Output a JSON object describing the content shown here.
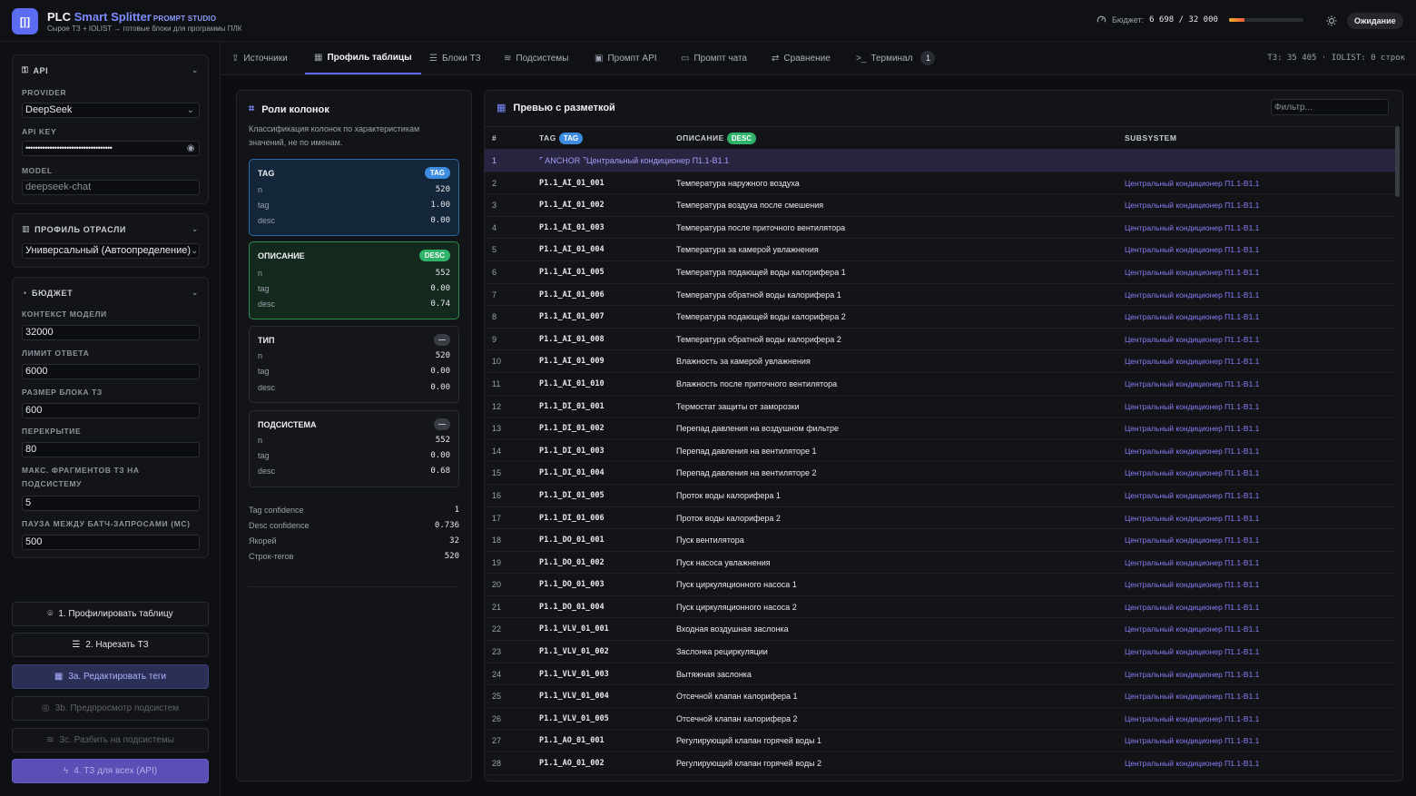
{
  "header": {
    "logo_glyph": "[|]",
    "title_part1": "PLC ",
    "title_part2": "Smart Splitter",
    "title_small": "PROMPT STUDIO",
    "subtitle": "Сырое ТЗ + IOLIST → готовые блоки для программы ПЛК",
    "budget_label": "Бюджет:",
    "budget_value": "6 698 / 32 000",
    "budget_fraction": 0.209,
    "status": "Ожидание"
  },
  "sidebar": {
    "api": {
      "title": "API",
      "provider_label": "PROVIDER",
      "provider_value": "DeepSeek",
      "apikey_label": "API KEY",
      "apikey_value": "••••••••••••••••••••••••••••••••••••",
      "model_label": "MODEL",
      "model_value": "deepseek-chat"
    },
    "industry": {
      "title": "ПРОФИЛЬ ОТРАСЛИ",
      "value": "Универсальный (Автоопределение)"
    },
    "budget": {
      "title": "БЮДЖЕТ",
      "context_label": "КОНТЕКСТ МОДЕЛИ",
      "context_value": "32000",
      "answer_label": "ЛИМИТ ОТВЕТА",
      "answer_value": "6000",
      "block_label": "РАЗМЕР БЛОКА ТЗ",
      "block_value": "600",
      "overlap_label": "ПЕРЕКРЫТИЕ",
      "overlap_value": "80",
      "maxfrag_label_1": "МАКС. ФРАГМЕНТОВ ТЗ НА",
      "maxfrag_label_2": "ПОДСИСТЕМУ",
      "maxfrag_value": "5",
      "pause_label": "ПАУЗА МЕЖДУ БАТЧ-ЗАПРОСАМИ (МС)",
      "pause_value": "500"
    },
    "buttons": {
      "profile": "1. Профилировать таблицу",
      "cut": "2. Нарезать ТЗ",
      "edit_tags": "3a. Редактировать теги",
      "preview_subsystems": "3b. Предпросмотр подсистем",
      "split_subsystems": "3c. Разбить на подсистемы",
      "tz_all": "4. ТЗ для всех (API)"
    }
  },
  "tabs": {
    "sources": "Источники",
    "profile": "Профиль таблицы",
    "blocks": "Блоки ТЗ",
    "subsystems": "Подсистемы",
    "prompt_api": "Промпт API",
    "prompt_chat": "Промпт чата",
    "compare": "Сравнение",
    "terminal": "Терминал",
    "terminal_count": "1",
    "info": "ТЗ: 35 405 · IOLIST: 0 строк"
  },
  "roles": {
    "title": "Роли колонок",
    "description": "Классификация колонок по характеристикам значений, не по именам.",
    "cards": [
      {
        "name": "TAG",
        "badge": "TAG",
        "n": "520",
        "tag": "1.00",
        "desc": "0.00"
      },
      {
        "name": "ОПИСАНИЕ",
        "badge": "DESC",
        "n": "552",
        "tag": "0.00",
        "desc": "0.74"
      },
      {
        "name": "ТИП",
        "badge": "—",
        "n": "520",
        "tag": "0.00",
        "desc": "0.00"
      },
      {
        "name": "ПОДСИСТЕМА",
        "badge": "—",
        "n": "552",
        "tag": "0.00",
        "desc": "0.68"
      }
    ],
    "row_labels": {
      "n": "n",
      "tag": "tag",
      "desc": "desc"
    },
    "stats": [
      {
        "label": "Tag confidence",
        "value": "1"
      },
      {
        "label": "Desc confidence",
        "value": "0.736"
      },
      {
        "label": "Якорей",
        "value": "32"
      },
      {
        "label": "Строк-тегов",
        "value": "520"
      }
    ]
  },
  "preview": {
    "title": "Превью с разметкой",
    "filter_placeholder": "Фильтр...",
    "columns": {
      "num": "#",
      "tag": "TAG",
      "tag_badge": "TAG",
      "desc": "ОПИСАНИЕ",
      "desc_badge": "DESC",
      "sub": "SUBSYSTEM"
    },
    "anchor": {
      "num": "1",
      "text": "⌜ ANCHOR ⌝Центральный кондиционер П1.1-В1.1"
    },
    "rows": [
      {
        "num": "2",
        "tag": "P1.1_AI_01_001",
        "desc": "Температура наружного воздуха",
        "sub": "Центральный кондиционер П1.1-В1.1"
      },
      {
        "num": "3",
        "tag": "P1.1_AI_01_002",
        "desc": "Температура воздуха после смешения",
        "sub": "Центральный кондиционер П1.1-В1.1"
      },
      {
        "num": "4",
        "tag": "P1.1_AI_01_003",
        "desc": "Температура после приточного вентилятора",
        "sub": "Центральный кондиционер П1.1-В1.1"
      },
      {
        "num": "5",
        "tag": "P1.1_AI_01_004",
        "desc": "Температура за камерой увлажнения",
        "sub": "Центральный кондиционер П1.1-В1.1"
      },
      {
        "num": "6",
        "tag": "P1.1_AI_01_005",
        "desc": "Температура подающей воды калорифера 1",
        "sub": "Центральный кондиционер П1.1-В1.1"
      },
      {
        "num": "7",
        "tag": "P1.1_AI_01_006",
        "desc": "Температура обратной воды калорифера 1",
        "sub": "Центральный кондиционер П1.1-В1.1"
      },
      {
        "num": "8",
        "tag": "P1.1_AI_01_007",
        "desc": "Температура подающей воды калорифера 2",
        "sub": "Центральный кондиционер П1.1-В1.1"
      },
      {
        "num": "9",
        "tag": "P1.1_AI_01_008",
        "desc": "Температура обратной воды калорифера 2",
        "sub": "Центральный кондиционер П1.1-В1.1"
      },
      {
        "num": "10",
        "tag": "P1.1_AI_01_009",
        "desc": "Влажность за камерой увлажнения",
        "sub": "Центральный кондиционер П1.1-В1.1"
      },
      {
        "num": "11",
        "tag": "P1.1_AI_01_010",
        "desc": "Влажность после приточного вентилятора",
        "sub": "Центральный кондиционер П1.1-В1.1"
      },
      {
        "num": "12",
        "tag": "P1.1_DI_01_001",
        "desc": "Термостат защиты от заморозки",
        "sub": "Центральный кондиционер П1.1-В1.1"
      },
      {
        "num": "13",
        "tag": "P1.1_DI_01_002",
        "desc": "Перепад давления на воздушном фильтре",
        "sub": "Центральный кондиционер П1.1-В1.1"
      },
      {
        "num": "14",
        "tag": "P1.1_DI_01_003",
        "desc": "Перепад давления на вентиляторе 1",
        "sub": "Центральный кондиционер П1.1-В1.1"
      },
      {
        "num": "15",
        "tag": "P1.1_DI_01_004",
        "desc": "Перепад давления на вентиляторе 2",
        "sub": "Центральный кондиционер П1.1-В1.1"
      },
      {
        "num": "16",
        "tag": "P1.1_DI_01_005",
        "desc": "Проток воды калорифера 1",
        "sub": "Центральный кондиционер П1.1-В1.1"
      },
      {
        "num": "17",
        "tag": "P1.1_DI_01_006",
        "desc": "Проток воды калорифера 2",
        "sub": "Центральный кондиционер П1.1-В1.1"
      },
      {
        "num": "18",
        "tag": "P1.1_DO_01_001",
        "desc": "Пуск вентилятора",
        "sub": "Центральный кондиционер П1.1-В1.1"
      },
      {
        "num": "19",
        "tag": "P1.1_DO_01_002",
        "desc": "Пуск насоса увлажнения",
        "sub": "Центральный кондиционер П1.1-В1.1"
      },
      {
        "num": "20",
        "tag": "P1.1_DO_01_003",
        "desc": "Пуск циркуляционного насоса 1",
        "sub": "Центральный кондиционер П1.1-В1.1"
      },
      {
        "num": "21",
        "tag": "P1.1_DO_01_004",
        "desc": "Пуск циркуляционного насоса 2",
        "sub": "Центральный кондиционер П1.1-В1.1"
      },
      {
        "num": "22",
        "tag": "P1.1_VLV_01_001",
        "desc": "Входная воздушная заслонка",
        "sub": "Центральный кондиционер П1.1-В1.1"
      },
      {
        "num": "23",
        "tag": "P1.1_VLV_01_002",
        "desc": "Заслонка рециркуляции",
        "sub": "Центральный кондиционер П1.1-В1.1"
      },
      {
        "num": "24",
        "tag": "P1.1_VLV_01_003",
        "desc": "Вытяжная заслонка",
        "sub": "Центральный кондиционер П1.1-В1.1"
      },
      {
        "num": "25",
        "tag": "P1.1_VLV_01_004",
        "desc": "Отсечной клапан калорифера 1",
        "sub": "Центральный кондиционер П1.1-В1.1"
      },
      {
        "num": "26",
        "tag": "P1.1_VLV_01_005",
        "desc": "Отсечной клапан калорифера 2",
        "sub": "Центральный кондиционер П1.1-В1.1"
      },
      {
        "num": "27",
        "tag": "P1.1_AO_01_001",
        "desc": "Регулирующий клапан горячей воды 1",
        "sub": "Центральный кондиционер П1.1-В1.1"
      },
      {
        "num": "28",
        "tag": "P1.1_AO_01_002",
        "desc": "Регулирующий клапан горячей воды 2",
        "sub": "Центральный кондиционер П1.1-В1.1"
      }
    ]
  }
}
